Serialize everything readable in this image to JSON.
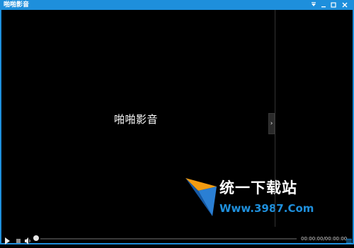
{
  "window": {
    "title": "啪啪影音",
    "controls": {
      "pin_icon": "pin-icon",
      "minimize_icon": "minimize-icon",
      "maximize_icon": "maximize-icon",
      "close_icon": "close-icon"
    },
    "accent": "#1e8fdc"
  },
  "video": {
    "center_title": "啪啪影音"
  },
  "watermark": {
    "text_cn": "统一下载站",
    "url": "Www.3987.Com"
  },
  "player": {
    "time": "00:00:00/00:00:00",
    "progress": 0
  }
}
